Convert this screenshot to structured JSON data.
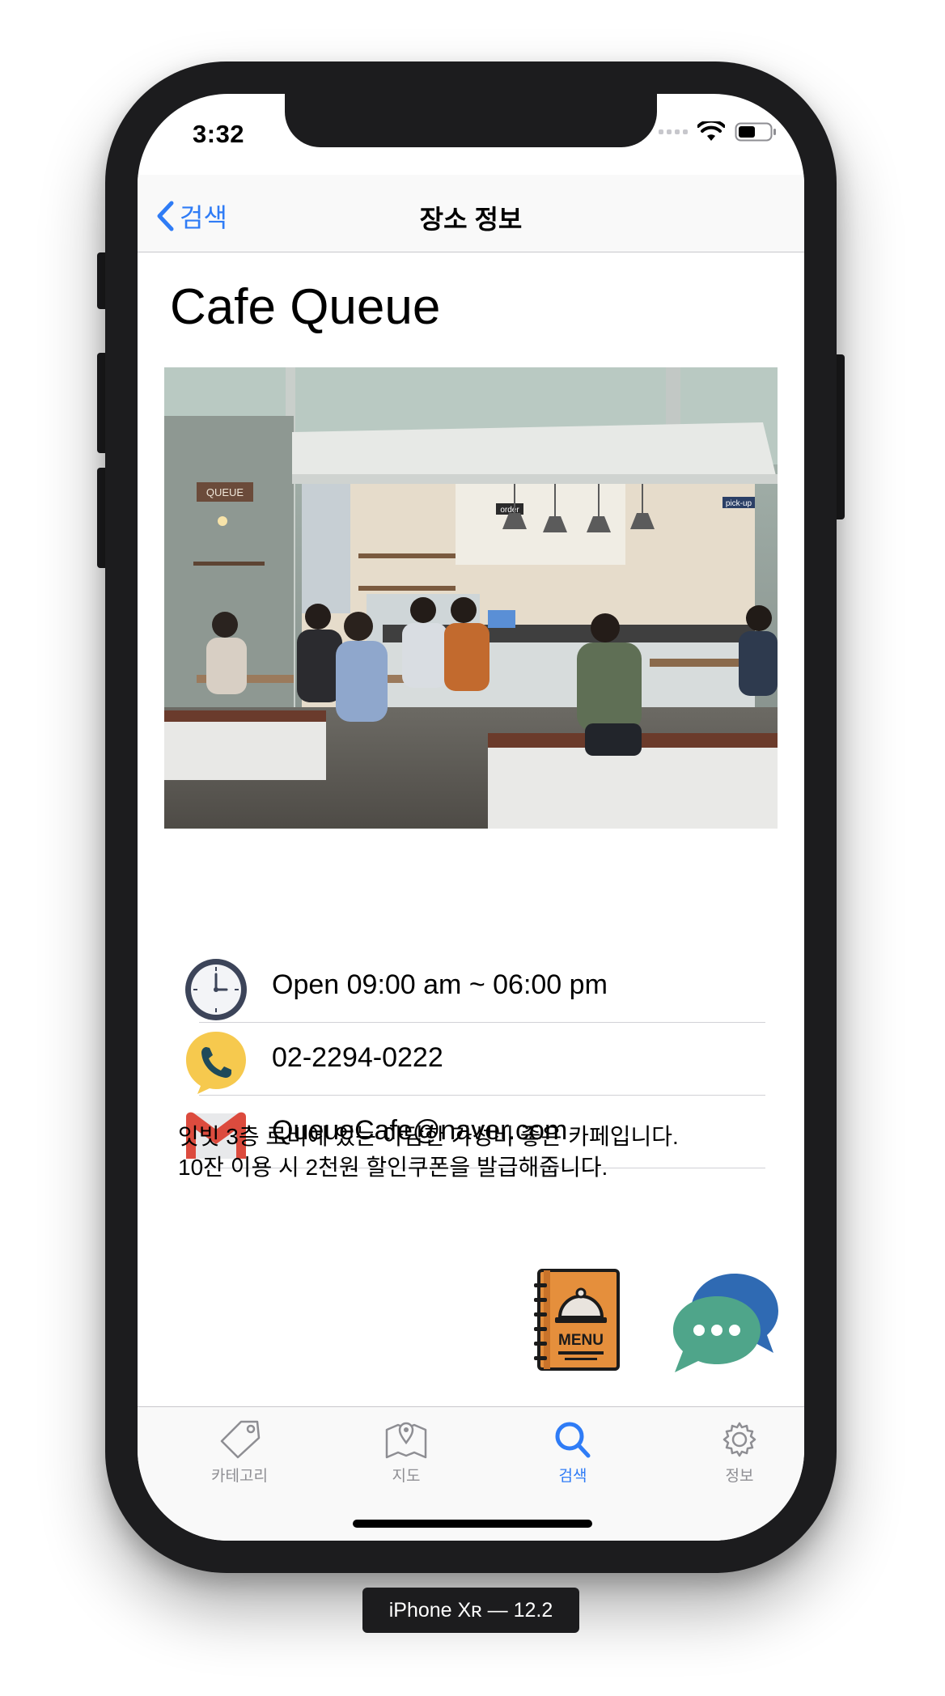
{
  "status_bar": {
    "time": "3:32"
  },
  "navbar": {
    "back_label": "검색",
    "title": "장소 정보"
  },
  "place": {
    "name": "Cafe Queue",
    "hours": "Open 09:00 am ~ 06:00 pm",
    "phone": "02-2294-0222",
    "email": "QueueCafe@naver.com",
    "description_line1": "잇빗 3층 로비에 있는 아담한 가성비 좋은 카페입니다.",
    "description_line2": "10잔 이용 시 2천원 할인쿠폰을 발급해줍니다."
  },
  "photo": {
    "sign_brand": "QUEUE",
    "sign_order": "order",
    "sign_pickup": "pick-up"
  },
  "buttons": {
    "menu_label": "MENU"
  },
  "tabs": [
    {
      "label": "카테고리",
      "icon": "tag-icon"
    },
    {
      "label": "지도",
      "icon": "map-icon"
    },
    {
      "label": "검색",
      "icon": "search-icon",
      "active": true
    },
    {
      "label": "정보",
      "icon": "gear-icon"
    }
  ],
  "device_label": "iPhone Xʀ — 12.2",
  "colors": {
    "accent": "#2f7cf6",
    "phone_icon_bg": "#f6c94e",
    "gmail_red": "#dc4b3e",
    "menu_orange": "#e58f3c",
    "chat_green": "#4fa58a",
    "chat_blue": "#2f6ab3"
  }
}
